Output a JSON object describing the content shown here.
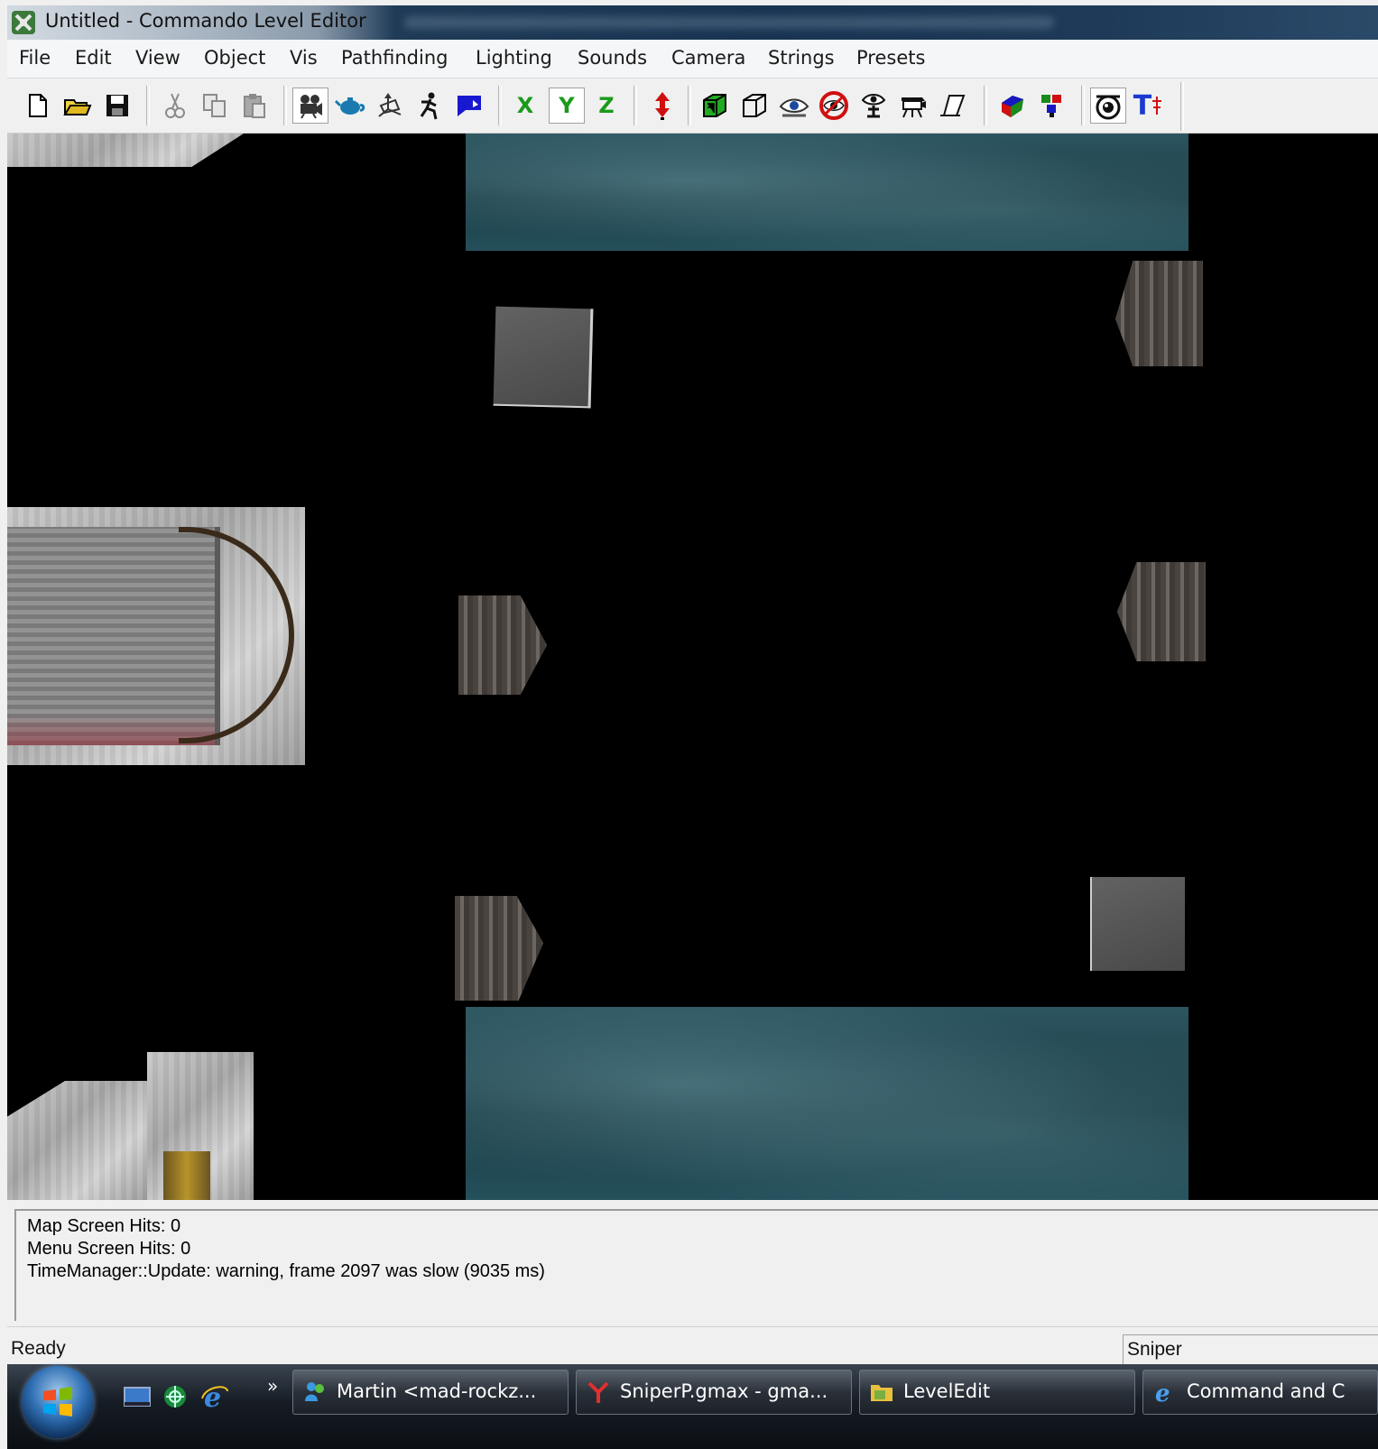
{
  "window": {
    "title": "Untitled - Commando Level Editor"
  },
  "menu": {
    "items": [
      "File",
      "Edit",
      "View",
      "Object",
      "Vis",
      "Pathfinding",
      "Lighting",
      "Sounds",
      "Camera",
      "Strings",
      "Presets"
    ]
  },
  "toolbar": {
    "axis_x": "X",
    "axis_y": "Y",
    "axis_z": "Z",
    "text_tool": "T",
    "colors": {
      "axis_x": "#1a9a1a",
      "axis_y": "#1a9a1a",
      "axis_z": "#1a9a1a",
      "arrow_red": "#d01010",
      "box_green": "#22aa22"
    }
  },
  "output": {
    "lines": [
      " Map Screen Hits: 0",
      "Menu Screen Hits: 0",
      "TimeManager::Update: warning, frame 2097 was slow (9035 ms)"
    ]
  },
  "status": {
    "text": "Ready",
    "pane": "Sniper"
  },
  "taskbar": {
    "chevron": "»",
    "tasks": [
      {
        "label": "Martin <mad-rockz...",
        "icon": "messenger-icon"
      },
      {
        "label": "SniperP.gmax - gma...",
        "icon": "gmax-icon"
      },
      {
        "label": "LevelEdit",
        "icon": "folder-icon"
      },
      {
        "label": "Command and C",
        "icon": "ie-icon"
      }
    ]
  }
}
